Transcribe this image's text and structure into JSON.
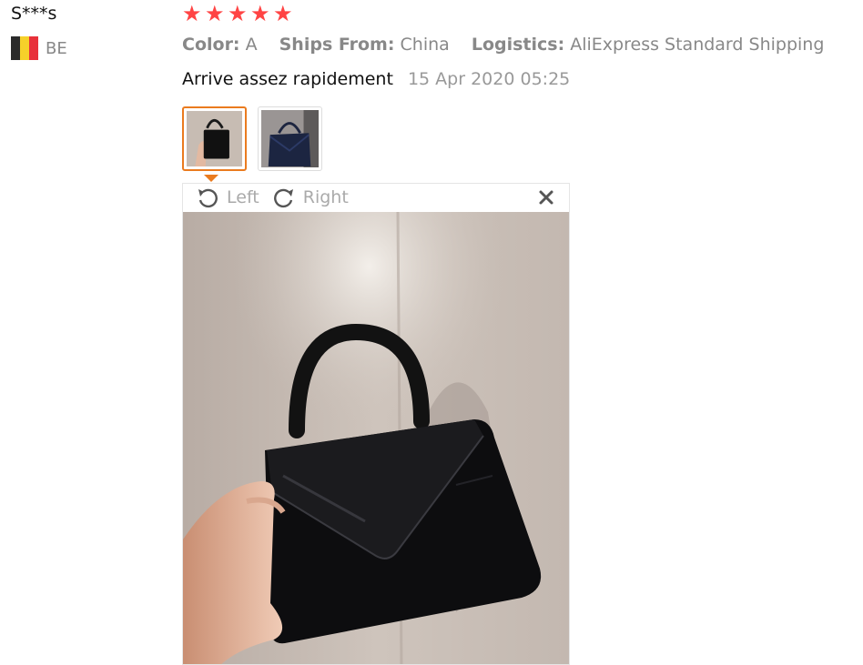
{
  "reviewer": {
    "name": "S***s",
    "country": "BE"
  },
  "rating": {
    "stars": 5,
    "max": 5,
    "color": "#ff4747"
  },
  "meta": {
    "color_label": "Color:",
    "color_value": "A",
    "ships_label": "Ships From:",
    "ships_value": "China",
    "logistics_label": "Logistics:",
    "logistics_value": "AliExpress Standard Shipping"
  },
  "review": {
    "text": "Arrive assez rapidement",
    "date": "15 Apr 2020 05:25"
  },
  "viewer": {
    "rotate_left_label": "Left",
    "rotate_right_label": "Right",
    "accent": "#ea7b1f"
  },
  "thumbnails": [
    {
      "selected": true
    },
    {
      "selected": false
    }
  ]
}
